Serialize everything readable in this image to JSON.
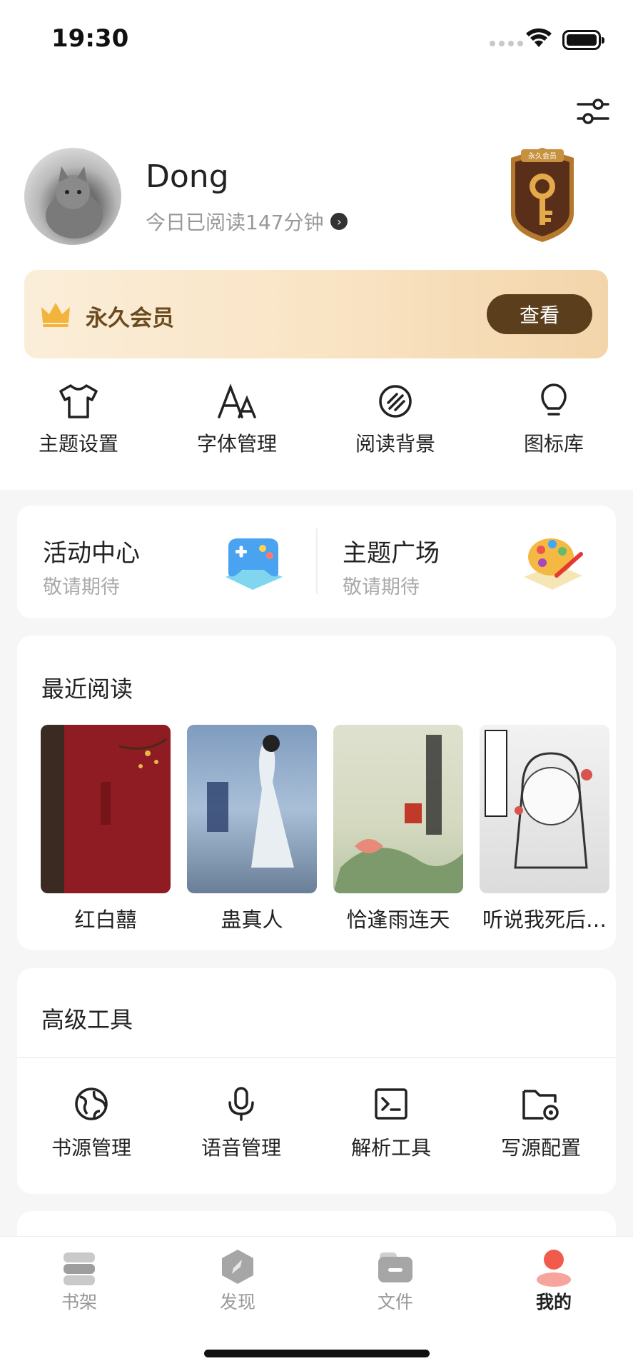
{
  "status_bar": {
    "time": "19:30"
  },
  "profile": {
    "name": "Dong",
    "reading_today": "今日已阅读147分钟",
    "badge_label": "永久会员"
  },
  "vip": {
    "label": "永久会员",
    "button": "查看"
  },
  "quick_actions": [
    {
      "label": "主题设置",
      "icon": "tshirt-icon"
    },
    {
      "label": "字体管理",
      "icon": "font-icon"
    },
    {
      "label": "阅读背景",
      "icon": "background-icon"
    },
    {
      "label": "图标库",
      "icon": "lightbulb-icon"
    }
  ],
  "activities": [
    {
      "title": "活动中心",
      "subtitle": "敬请期待",
      "icon": "gamepad-icon"
    },
    {
      "title": "主题广场",
      "subtitle": "敬请期待",
      "icon": "palette-icon"
    }
  ],
  "recent": {
    "title": "最近阅读",
    "books": [
      {
        "title": "红白囍",
        "cover_color": "#8e1c22"
      },
      {
        "title": "蛊真人",
        "cover_color": "#8faecd"
      },
      {
        "title": "恰逢雨连天",
        "cover_color": "#d9dcc7"
      },
      {
        "title": "听说我死后…",
        "cover_color": "#e8e8e8"
      }
    ]
  },
  "tools": {
    "title": "高级工具",
    "items": [
      {
        "label": "书源管理",
        "icon": "globe-icon"
      },
      {
        "label": "语音管理",
        "icon": "microphone-icon"
      },
      {
        "label": "解析工具",
        "icon": "terminal-icon"
      },
      {
        "label": "写源配置",
        "icon": "folder-gear-icon"
      }
    ]
  },
  "tabbar": [
    {
      "label": "书架",
      "icon": "bookshelf-icon"
    },
    {
      "label": "发现",
      "icon": "compass-icon"
    },
    {
      "label": "文件",
      "icon": "folder-icon"
    },
    {
      "label": "我的",
      "icon": "person-icon",
      "active": true
    }
  ],
  "colors": {
    "accent": "#f25b4c",
    "vip_brown": "#5b3f1c"
  }
}
